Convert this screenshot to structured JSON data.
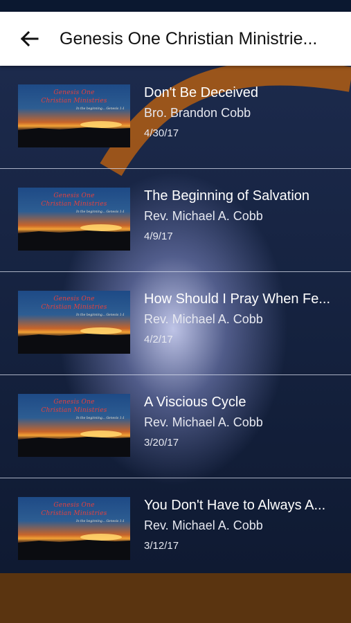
{
  "header": {
    "title": "Genesis One Christian Ministrie...",
    "back_icon": "arrow-left-icon"
  },
  "thumbnail": {
    "line1": "Genesis One",
    "line2": "Christian Ministries",
    "line3": "In the beginning... Genesis 1:1"
  },
  "sermons": [
    {
      "title": "Don't Be Deceived",
      "speaker": "Bro. Brandon Cobb",
      "date": "4/30/17"
    },
    {
      "title": "The Beginning of Salvation",
      "speaker": "Rev. Michael A. Cobb",
      "date": "4/9/17"
    },
    {
      "title": "How Should I Pray When Fe...",
      "speaker": "Rev. Michael A. Cobb",
      "date": "4/2/17"
    },
    {
      "title": "A Viscious Cycle",
      "speaker": "Rev. Michael A. Cobb",
      "date": "3/20/17"
    },
    {
      "title": "You Don't Have to Always A...",
      "speaker": "Rev. Michael A. Cobb",
      "date": "3/12/17"
    }
  ],
  "colors": {
    "status_bar": "#0b1830",
    "app_bar": "#ffffff",
    "background": "#15223f",
    "accent_swoosh": "#b5651d",
    "bottom_bar": "#5a3410"
  }
}
